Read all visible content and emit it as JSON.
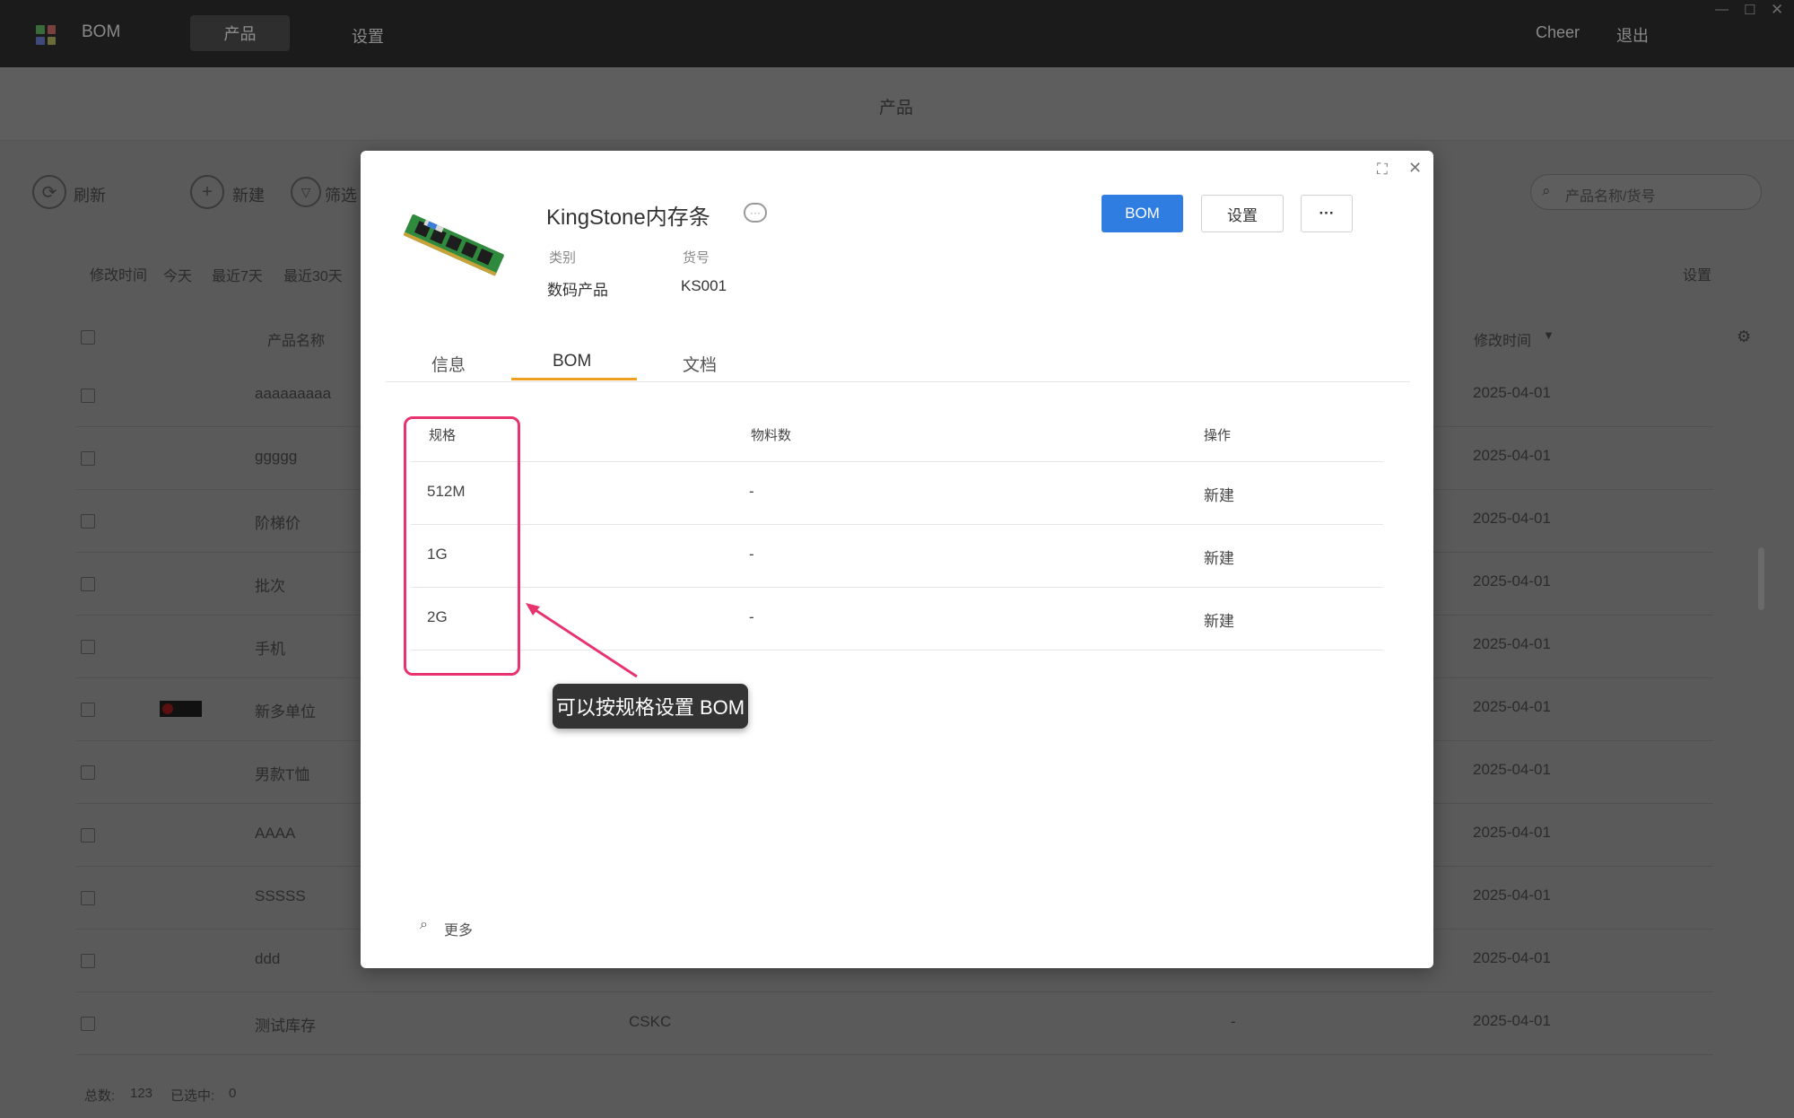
{
  "app": {
    "name": "BOM",
    "nav": [
      "产品",
      "设置"
    ],
    "user": "Cheer",
    "logout": "退出"
  },
  "page": {
    "title": "产品",
    "toolbar": {
      "refresh": "刷新",
      "new": "新建",
      "filter": "筛选"
    },
    "search_placeholder": "产品名称/货号",
    "date_filter": {
      "label": "修改时间",
      "options": [
        "今天",
        "最近7天",
        "最近30天"
      ]
    },
    "settings_link": "设置",
    "columns": {
      "name": "产品名称",
      "modified": "修改时间"
    },
    "rows": [
      {
        "name": "aaaaaaaaa",
        "sku": "",
        "extra": "",
        "date": "2025-04-01"
      },
      {
        "name": "ggggg",
        "sku": "",
        "extra": "",
        "date": "2025-04-01"
      },
      {
        "name": "阶梯价",
        "sku": "",
        "extra": "",
        "date": "2025-04-01"
      },
      {
        "name": "批次",
        "sku": "",
        "extra": "",
        "date": "2025-04-01"
      },
      {
        "name": "手机",
        "sku": "",
        "extra": "",
        "date": "2025-04-01"
      },
      {
        "name": "新多单位",
        "sku": "",
        "extra": "",
        "date": "2025-04-01"
      },
      {
        "name": "男款T恤",
        "sku": "",
        "extra": "",
        "date": "2025-04-01"
      },
      {
        "name": "AAAA",
        "sku": "",
        "extra": "",
        "date": "2025-04-01"
      },
      {
        "name": "SSSSS",
        "sku": "",
        "extra": "",
        "date": "2025-04-01"
      },
      {
        "name": "ddd",
        "sku": "",
        "extra": "",
        "date": "2025-04-01"
      },
      {
        "name": "测试库存",
        "sku": "CSKC",
        "extra": "-",
        "date": "2025-04-01"
      }
    ],
    "footer": {
      "total_label": "总数:",
      "total": "123",
      "selected_label": "已选中:",
      "selected": "0"
    }
  },
  "modal": {
    "product_name": "KingStone内存条",
    "category_label": "类别",
    "category": "数码产品",
    "sku_label": "货号",
    "sku": "KS001",
    "buttons": {
      "bom": "BOM",
      "settings": "设置",
      "more": "···"
    },
    "tabs": [
      "信息",
      "BOM",
      "文档"
    ],
    "active_tab": "BOM",
    "table": {
      "headers": [
        "规格",
        "物料数",
        "操作"
      ],
      "rows": [
        {
          "spec": "512M",
          "count": "-",
          "action": "新建"
        },
        {
          "spec": "1G",
          "count": "-",
          "action": "新建"
        },
        {
          "spec": "2G",
          "count": "-",
          "action": "新建"
        }
      ]
    },
    "more_link": "更多",
    "tooltip": "可以按规格设置 BOM",
    "colors": {
      "primary": "#2f7de1",
      "tab_underline": "#f0a020",
      "highlight": "#e8336e"
    }
  }
}
